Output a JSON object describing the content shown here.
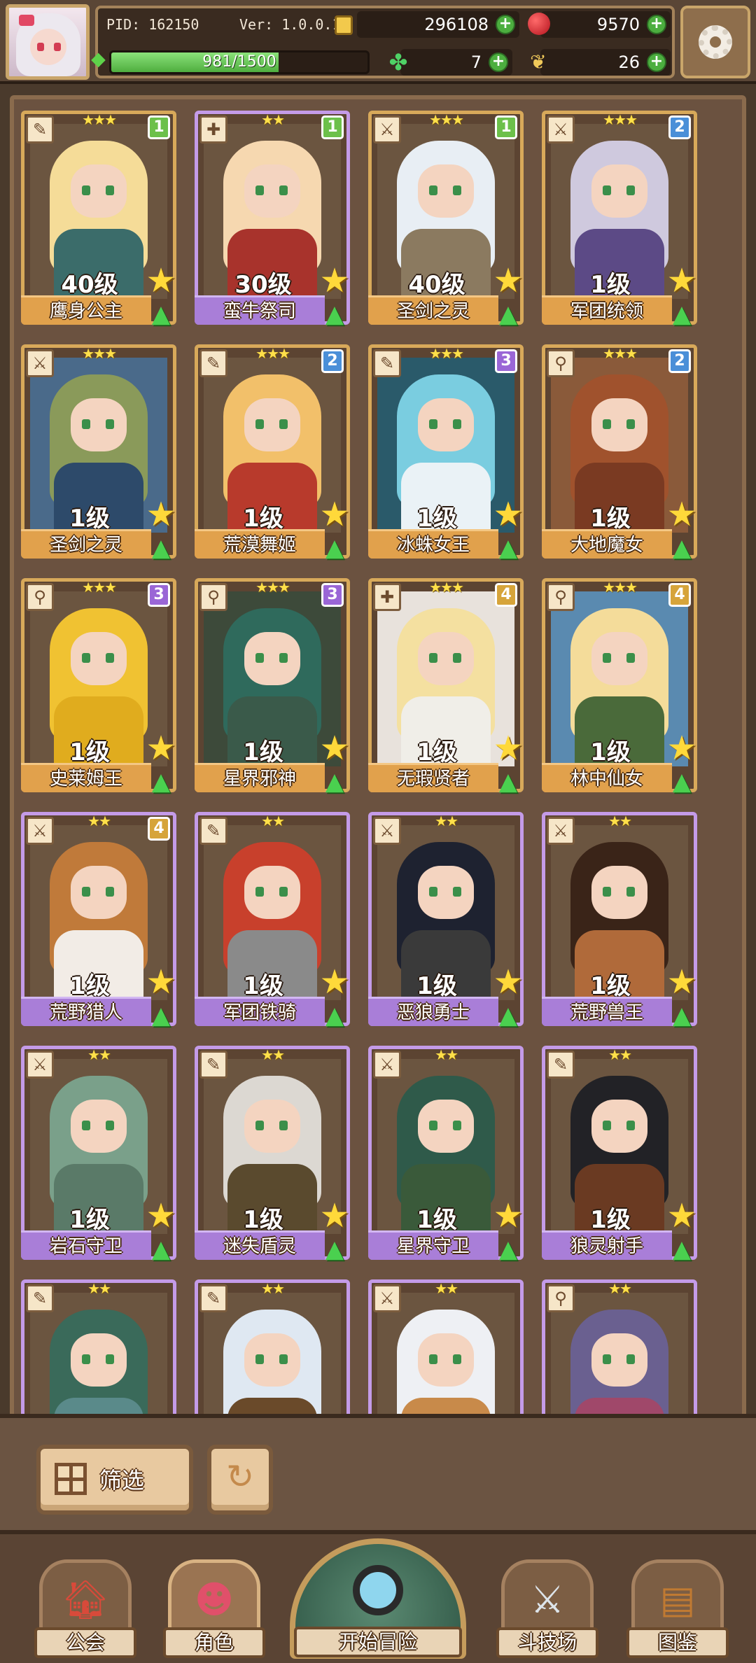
{
  "header": {
    "pid": "PID: 162150",
    "version": "Ver: 1.0.0.1",
    "gold": "296108",
    "gems": "9570",
    "clover": "7",
    "feather": "26",
    "xp_text": "981/1500",
    "xp_fraction": 0.654
  },
  "cards": [
    {
      "name": "鹰身公主",
      "level": "40级",
      "stars": "★★★",
      "rank": "1",
      "rank_color": "#6cc04a",
      "frame": "gold",
      "type_icon": "✎",
      "hair": "#f5dc98",
      "body": "#3b6c6a",
      "bg": "#6b5540"
    },
    {
      "name": "蛮牛祭司",
      "level": "30级",
      "stars": "★★",
      "rank": "1",
      "rank_color": "#6cc04a",
      "frame": "purple",
      "type_icon": "✚",
      "hair": "#f6d8b0",
      "body": "#a8332c",
      "bg": "#6b5540"
    },
    {
      "name": "圣剑之灵",
      "level": "40级",
      "stars": "★★★",
      "rank": "1",
      "rank_color": "#6cc04a",
      "frame": "gold",
      "type_icon": "⚔",
      "hair": "#e8eef4",
      "body": "#8b7a60",
      "bg": "#6b5540"
    },
    {
      "name": "军团统领",
      "level": "1级",
      "stars": "★★★",
      "rank": "2",
      "rank_color": "#4a8fd8",
      "frame": "gold",
      "type_icon": "⚔",
      "hair": "#cfc9de",
      "body": "#5c4a86",
      "bg": "#6b5540"
    },
    {
      "name": "圣剑之灵",
      "level": "1级",
      "stars": "★★★",
      "rank": "",
      "rank_color": "",
      "frame": "gold",
      "type_icon": "⚔",
      "hair": "#8a9a5a",
      "body": "#2d4a6a",
      "bg": "#4a6a8a"
    },
    {
      "name": "荒漠舞姬",
      "level": "1级",
      "stars": "★★★",
      "rank": "2",
      "rank_color": "#4a8fd8",
      "frame": "gold",
      "type_icon": "✎",
      "hair": "#f2c06a",
      "body": "#b83a2c",
      "bg": "#6b5540"
    },
    {
      "name": "冰蛛女王",
      "level": "1级",
      "stars": "★★★",
      "rank": "3",
      "rank_color": "#9a66d6",
      "frame": "gold",
      "type_icon": "✎",
      "hair": "#7acde0",
      "body": "#eaf2f6",
      "bg": "#2a5a6a"
    },
    {
      "name": "大地魔女",
      "level": "1级",
      "stars": "★★★",
      "rank": "2",
      "rank_color": "#4a8fd8",
      "frame": "gold",
      "type_icon": "⚲",
      "hair": "#a0522d",
      "body": "#7a3a22",
      "bg": "#8a5a3a"
    },
    {
      "name": "史莱姆王",
      "level": "1级",
      "stars": "★★★",
      "rank": "3",
      "rank_color": "#9a66d6",
      "frame": "gold",
      "type_icon": "⚲",
      "hair": "#f0c232",
      "body": "#e0ac1e",
      "bg": "#6b5540"
    },
    {
      "name": "星界邪神",
      "level": "1级",
      "stars": "★★★",
      "rank": "3",
      "rank_color": "#9a66d6",
      "frame": "gold",
      "type_icon": "⚲",
      "hair": "#2f6a5c",
      "body": "#3a5a4a",
      "bg": "#3d4a3a"
    },
    {
      "name": "无瑕贤者",
      "level": "1级",
      "stars": "★★★",
      "rank": "4",
      "rank_color": "#d6a43a",
      "frame": "gold",
      "type_icon": "✚",
      "hair": "#f4e0a0",
      "body": "#f0eee8",
      "bg": "#e8e2dc"
    },
    {
      "name": "林中仙女",
      "level": "1级",
      "stars": "★★★",
      "rank": "4",
      "rank_color": "#d6a43a",
      "frame": "gold",
      "type_icon": "⚲",
      "hair": "#f4dc9a",
      "body": "#4a6a3a",
      "bg": "#5a8ab0"
    },
    {
      "name": "荒野猎人",
      "level": "1级",
      "stars": "★★",
      "rank": "4",
      "rank_color": "#d6a43a",
      "frame": "purple",
      "type_icon": "⚔",
      "hair": "#c07a3a",
      "body": "#f2ece6",
      "bg": "#6b5540"
    },
    {
      "name": "军团铁骑",
      "level": "1级",
      "stars": "★★",
      "rank": "",
      "rank_color": "",
      "frame": "purple",
      "type_icon": "✎",
      "hair": "#c8402c",
      "body": "#8a8a8a",
      "bg": "#6b5540"
    },
    {
      "name": "恶狼勇士",
      "level": "1级",
      "stars": "★★",
      "rank": "",
      "rank_color": "",
      "frame": "purple",
      "type_icon": "⚔",
      "hair": "#1e2230",
      "body": "#3a3a3a",
      "bg": "#6b5540"
    },
    {
      "name": "荒野兽王",
      "level": "1级",
      "stars": "★★",
      "rank": "",
      "rank_color": "",
      "frame": "purple",
      "type_icon": "⚔",
      "hair": "#3a2418",
      "body": "#b06a3a",
      "bg": "#6b5540"
    },
    {
      "name": "岩石守卫",
      "level": "1级",
      "stars": "★★",
      "rank": "",
      "rank_color": "",
      "frame": "purple",
      "type_icon": "⚔",
      "hair": "#7aa08a",
      "body": "#5a7a68",
      "bg": "#6b5540"
    },
    {
      "name": "迷失盾灵",
      "level": "1级",
      "stars": "★★",
      "rank": "",
      "rank_color": "",
      "frame": "purple",
      "type_icon": "✎",
      "hair": "#dcd8d2",
      "body": "#5a4a2e",
      "bg": "#6b5540"
    },
    {
      "name": "星界守卫",
      "level": "1级",
      "stars": "★★",
      "rank": "",
      "rank_color": "",
      "frame": "purple",
      "type_icon": "⚔",
      "hair": "#2f5a4a",
      "body": "#3a5a3a",
      "bg": "#6b5540"
    },
    {
      "name": "狼灵射手",
      "level": "1级",
      "stars": "★★",
      "rank": "",
      "rank_color": "",
      "frame": "purple",
      "type_icon": "✎",
      "hair": "#222226",
      "body": "#6a3a22",
      "bg": "#6b5540"
    },
    {
      "name": "",
      "level": "",
      "stars": "★★",
      "rank": "",
      "rank_color": "",
      "frame": "purple",
      "type_icon": "✎",
      "hair": "#3a6a5a",
      "body": "#5a8a8a",
      "bg": "#6b5540"
    },
    {
      "name": "",
      "level": "",
      "stars": "★★",
      "rank": "",
      "rank_color": "",
      "frame": "purple",
      "type_icon": "✎",
      "hair": "#dfe8f2",
      "body": "#6a4a2a",
      "bg": "#6b5540"
    },
    {
      "name": "",
      "level": "",
      "stars": "★★",
      "rank": "",
      "rank_color": "",
      "frame": "purple",
      "type_icon": "⚔",
      "hair": "#eef0f4",
      "body": "#c88a4a",
      "bg": "#6b5540"
    },
    {
      "name": "",
      "level": "",
      "stars": "★★",
      "rank": "",
      "rank_color": "",
      "frame": "purple",
      "type_icon": "⚲",
      "hair": "#6a6090",
      "body": "#a0486a",
      "bg": "#6b5540"
    }
  ],
  "filter": {
    "label": "筛选"
  },
  "nav": {
    "guild": "公会",
    "character": "角色",
    "adventure": "开始冒险",
    "arena": "斗技场",
    "codex": "图鉴"
  }
}
